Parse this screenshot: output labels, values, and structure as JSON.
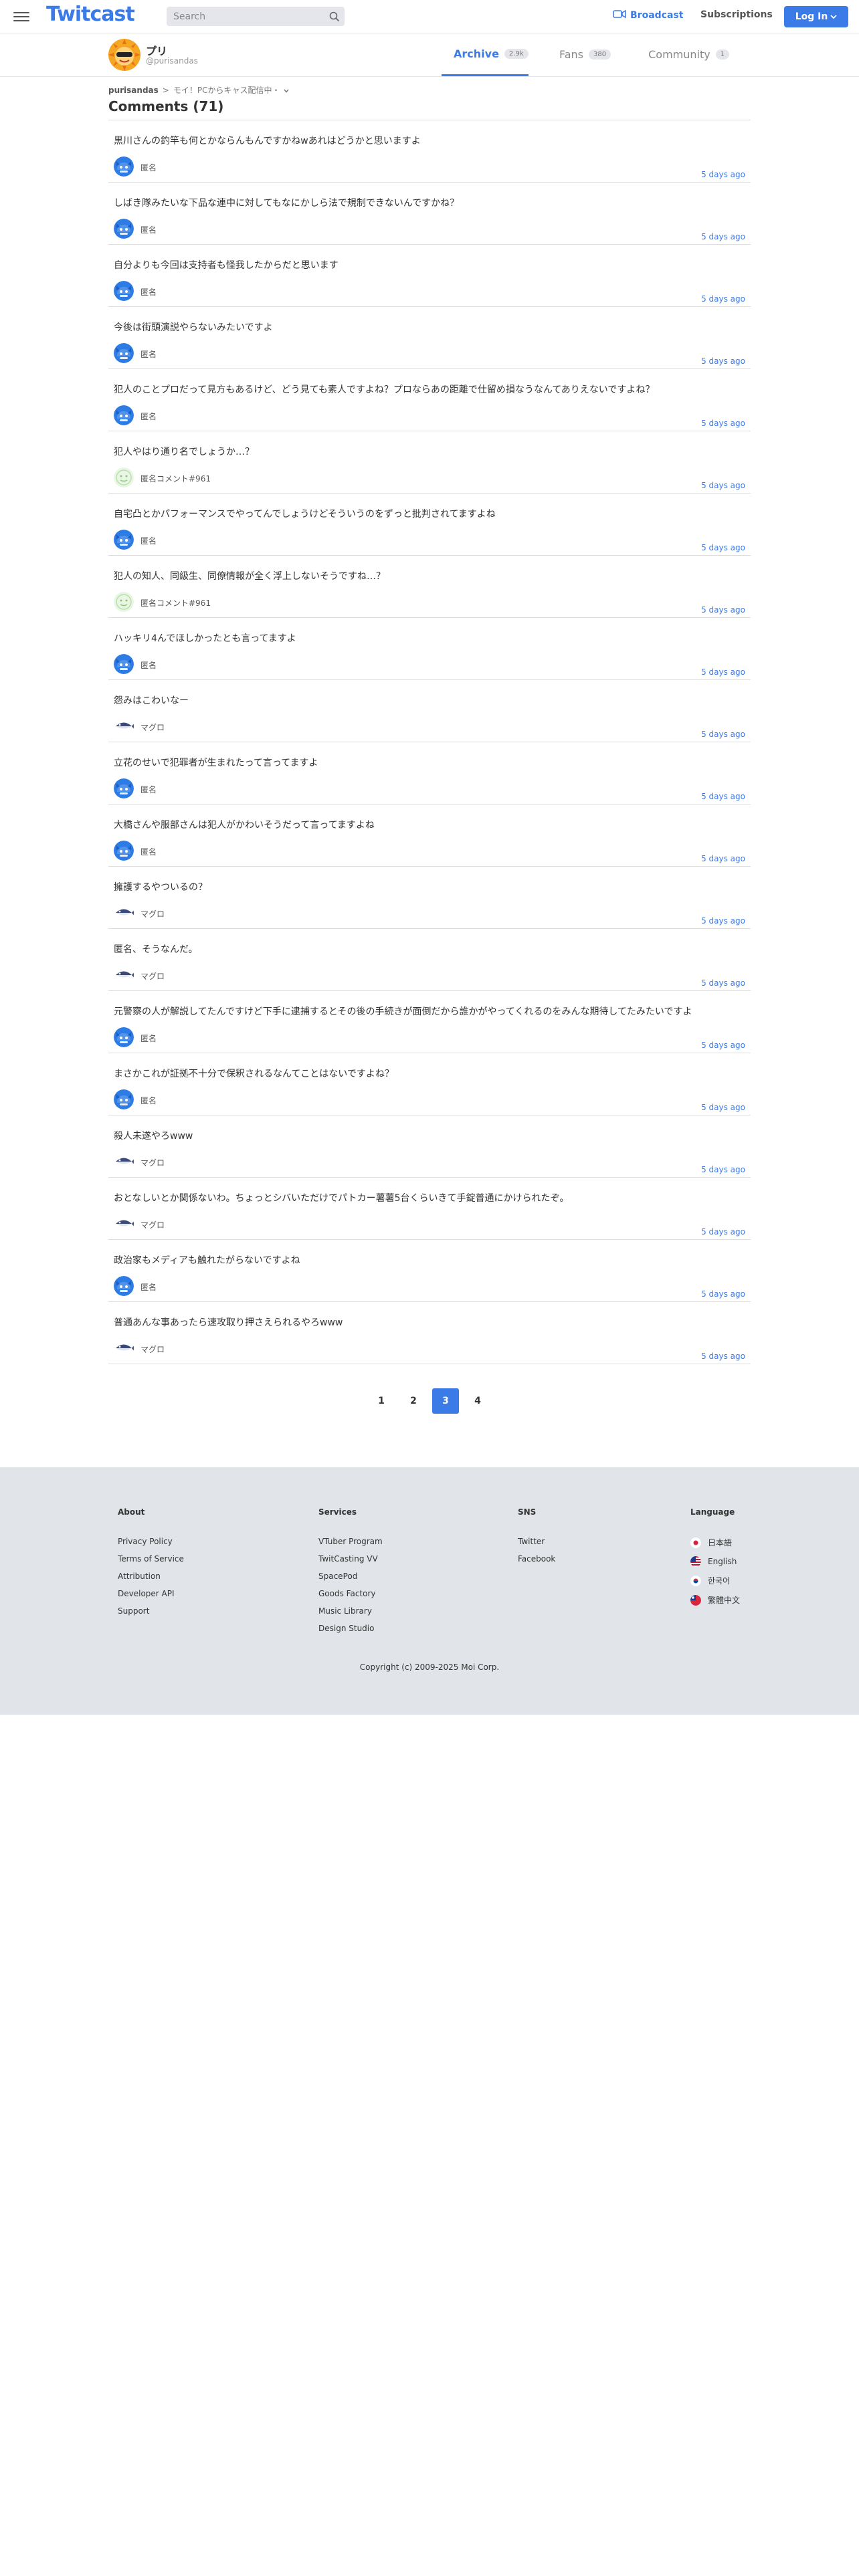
{
  "header": {
    "logo": "Twitcast",
    "search_placeholder": "Search",
    "broadcast_label": "Broadcast",
    "subscriptions_label": "Subscriptions",
    "login_label": "Log In",
    "accent_color": "#3b7be8"
  },
  "profile": {
    "name": "プリ",
    "handle": "@purisandas",
    "tabs": [
      {
        "label": "Archive",
        "count": "2.9k"
      },
      {
        "label": "Fans",
        "count": "380"
      },
      {
        "label": "Community",
        "count": "1"
      }
    ]
  },
  "breadcrumb": {
    "user": "purisandas",
    "separator": ">",
    "category": "モイ！PCからキャス配信中・"
  },
  "page_title": "Comments (71)",
  "comments": [
    {
      "text": "黒川さんの釣竿も何とかならんもんですかねwあれはどうかと思いますよ",
      "name": "匿名",
      "time": "5 days ago",
      "avatar": "blue"
    },
    {
      "text": "しばき隊みたいな下品な連中に対してもなにかしら法で規制できないんですかね？",
      "name": "匿名",
      "time": "5 days ago",
      "avatar": "blue"
    },
    {
      "text": "自分よりも今回は支持者も怪我したからだと思います",
      "name": "匿名",
      "time": "5 days ago",
      "avatar": "blue"
    },
    {
      "text": "今後は街頭演説やらないみたいですよ",
      "name": "匿名",
      "time": "5 days ago",
      "avatar": "blue"
    },
    {
      "text": "犯人のことプロだって見方もあるけど、どう見ても素人ですよね？プロならあの距離で仕留め損なうなんてありえないですよね？",
      "name": "匿名",
      "time": "5 days ago",
      "avatar": "blue"
    },
    {
      "text": "犯人やはり通り名でしょうか…？",
      "name": "匿名コメント#961",
      "time": "5 days ago",
      "avatar": "green"
    },
    {
      "text": "自宅凸とかパフォーマンスでやってんでしょうけどそういうのをずっと批判されてますよね",
      "name": "匿名",
      "time": "5 days ago",
      "avatar": "blue"
    },
    {
      "text": "犯人の知人、同級生、同僚情報が全く浮上しないそうですね…？",
      "name": "匿名コメント#961",
      "time": "5 days ago",
      "avatar": "green"
    },
    {
      "text": "ハッキリ4んでほしかったとも言ってますよ",
      "name": "匿名",
      "time": "5 days ago",
      "avatar": "blue"
    },
    {
      "text": "怨みはこわいなー",
      "name": "マグロ",
      "time": "5 days ago",
      "avatar": "maguro"
    },
    {
      "text": "立花のせいで犯罪者が生まれたって言ってますよ",
      "name": "匿名",
      "time": "5 days ago",
      "avatar": "blue"
    },
    {
      "text": "大橋さんや服部さんは犯人がかわいそうだって言ってますよね",
      "name": "匿名",
      "time": "5 days ago",
      "avatar": "blue"
    },
    {
      "text": "擁護するやついるの？",
      "name": "マグロ",
      "time": "5 days ago",
      "avatar": "maguro"
    },
    {
      "text": "匿名、そうなんだ。",
      "name": "マグロ",
      "time": "5 days ago",
      "avatar": "maguro"
    },
    {
      "text": "元警察の人が解説してたんですけど下手に逮捕するとその後の手続きが面倒だから誰かがやってくれるのをみんな期待してたみたいですよ",
      "name": "匿名",
      "time": "5 days ago",
      "avatar": "blue"
    },
    {
      "text": "まさかこれが証拠不十分で保釈されるなんてことはないですよね？",
      "name": "匿名",
      "time": "5 days ago",
      "avatar": "blue"
    },
    {
      "text": "殺人未遂やろwww",
      "name": "マグロ",
      "time": "5 days ago",
      "avatar": "maguro"
    },
    {
      "text": "おとなしいとか関係ないわ。ちょっとシバいただけでパトカー薯薯5台くらいきて手錠普通にかけられたぞ。",
      "name": "マグロ",
      "time": "5 days ago",
      "avatar": "maguro"
    },
    {
      "text": "政治家もメディアも触れたがらないですよね",
      "name": "匿名",
      "time": "5 days ago",
      "avatar": "blue"
    },
    {
      "text": "普通あんな事あったら速攻取り押さえられるやろwww",
      "name": "マグロ",
      "time": "5 days ago",
      "avatar": "maguro"
    }
  ],
  "pagination": {
    "pages": [
      "1",
      "2",
      "3",
      "4"
    ],
    "current": "3"
  },
  "footer": {
    "about": {
      "heading": "About",
      "links": [
        "Privacy Policy",
        "Terms of Service",
        "Attribution",
        "Developer API",
        "Support"
      ]
    },
    "services": {
      "heading": "Services",
      "links": [
        "VTuber Program",
        "TwitCasting VV",
        "SpacePod",
        "Goods Factory",
        "Music Library",
        "Design Studio"
      ]
    },
    "sns": {
      "heading": "SNS",
      "links": [
        "Twitter",
        "Facebook"
      ]
    },
    "language": {
      "heading": "Language",
      "links": [
        "日本語",
        "English",
        "한국어",
        "繁體中文"
      ]
    },
    "copyright": "Copyright (c) 2009-2025 Moi Corp."
  }
}
